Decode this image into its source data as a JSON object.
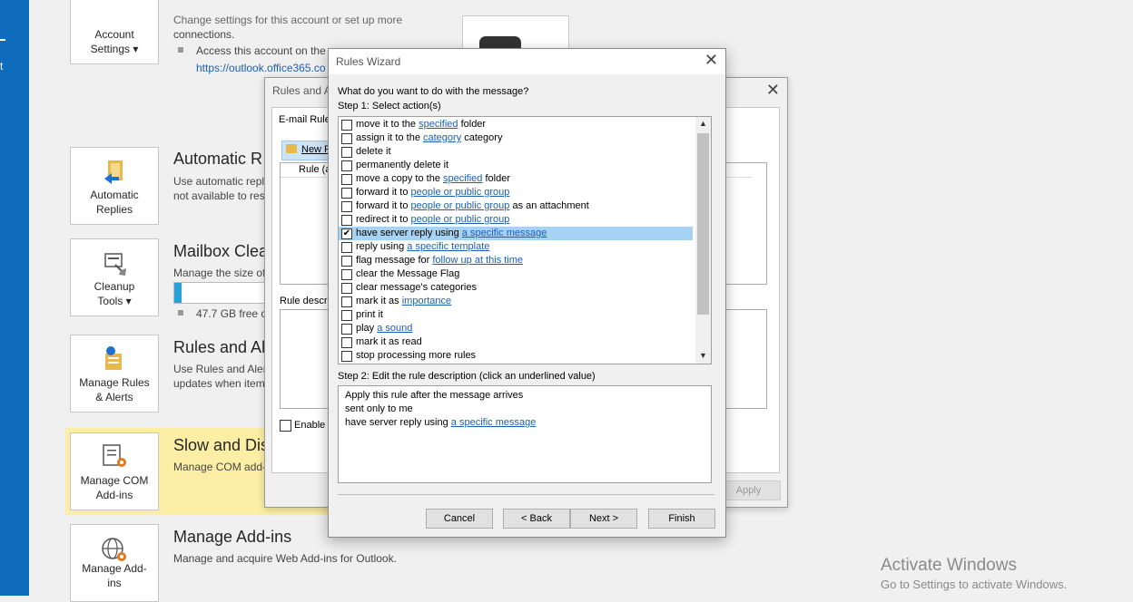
{
  "sidebar": {
    "mark": "t"
  },
  "tiles": {
    "account_settings": "Account Settings ▾",
    "automatic_replies": "Automatic Replies",
    "cleanup_tools": "Cleanup Tools ▾",
    "manage_rules": "Manage Rules & Alerts",
    "manage_com": "Manage COM Add-ins",
    "manage_addins": "Manage Add-ins"
  },
  "account": {
    "desc_top": "Change settings for this account or set up more",
    "desc_connections": "connections.",
    "access_text": "Access this account on the",
    "url": "https://outlook.office365.co"
  },
  "sections": {
    "automatic_replies": {
      "title": "Automatic R",
      "desc1": "Use automatic repli",
      "desc2": "not available to res"
    },
    "mailbox": {
      "title": "Mailbox Clea",
      "desc": "Manage the size of",
      "free": "47.7 GB free of"
    },
    "rules": {
      "title": "Rules and Al",
      "desc1": "Use Rules and Alert",
      "desc2": "updates when item"
    },
    "slow": {
      "title": "Slow and Dis",
      "desc": "Manage COM add-"
    },
    "addins": {
      "title": "Manage Add-ins",
      "desc": "Manage and acquire Web Add-ins for Outlook."
    }
  },
  "bg_dialog": {
    "title": "Rules and A",
    "tab": "E-mail Rule",
    "new_rule": "New R",
    "col_rule": "Rule (a",
    "rule_desc": "Rule descr",
    "enable": "Enable",
    "apply": "Apply"
  },
  "wizard": {
    "title": "Rules Wizard",
    "question": "What do you want to do with the message?",
    "step1": "Step 1: Select action(s)",
    "step2": "Step 2: Edit the rule description (click an underlined value)",
    "actions": [
      {
        "pre": "move it to the ",
        "link": "specified",
        "post": " folder",
        "checked": false
      },
      {
        "pre": "assign it to the ",
        "link": "category",
        "post": " category",
        "checked": false
      },
      {
        "pre": "delete it",
        "link": "",
        "post": "",
        "checked": false
      },
      {
        "pre": "permanently delete it",
        "link": "",
        "post": "",
        "checked": false
      },
      {
        "pre": "move a copy to the ",
        "link": "specified",
        "post": " folder",
        "checked": false
      },
      {
        "pre": "forward it to ",
        "link": "people or public group",
        "post": "",
        "checked": false
      },
      {
        "pre": "forward it to ",
        "link": "people or public group",
        "post": " as an attachment",
        "checked": false
      },
      {
        "pre": "redirect it to ",
        "link": "people or public group",
        "post": "",
        "checked": false
      },
      {
        "pre": "have server reply using ",
        "link": "a specific message",
        "post": "",
        "checked": true
      },
      {
        "pre": "reply using ",
        "link": "a specific template",
        "post": "",
        "checked": false
      },
      {
        "pre": "flag message for ",
        "link": "follow up at this time",
        "post": "",
        "checked": false
      },
      {
        "pre": "clear the Message Flag",
        "link": "",
        "post": "",
        "checked": false
      },
      {
        "pre": "clear message's categories",
        "link": "",
        "post": "",
        "checked": false
      },
      {
        "pre": "mark it as ",
        "link": "importance",
        "post": "",
        "checked": false
      },
      {
        "pre": "print it",
        "link": "",
        "post": "",
        "checked": false
      },
      {
        "pre": "play ",
        "link": "a sound",
        "post": "",
        "checked": false
      },
      {
        "pre": "mark it as read",
        "link": "",
        "post": "",
        "checked": false
      },
      {
        "pre": "stop processing more rules",
        "link": "",
        "post": "",
        "checked": false
      }
    ],
    "description": {
      "line1": "Apply this rule after the message arrives",
      "line2": "sent only to me",
      "line3_pre": "have server reply using ",
      "line3_link": "a specific message"
    },
    "buttons": {
      "cancel": "Cancel",
      "back": "< Back",
      "next": "Next >",
      "finish": "Finish"
    }
  },
  "watermark": {
    "line1": "Activate Windows",
    "line2": "Go to Settings to activate Windows."
  }
}
